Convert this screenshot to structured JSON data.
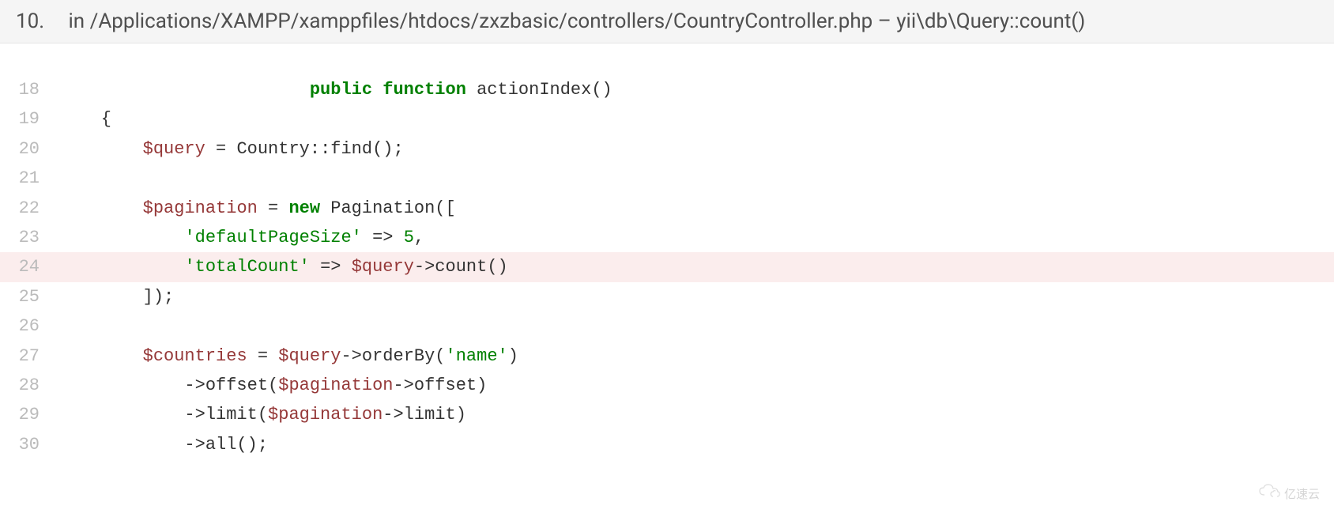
{
  "header": {
    "number": "10.",
    "prefix": "in ",
    "path": "/Applications/XAMPP/xamppfiles/htdocs/zxzbasic/controllers/CountryController.php",
    "separator": " – ",
    "method": "yii\\db\\Query::count()"
  },
  "code": {
    "highlighted_line": 24,
    "lines": [
      {
        "num": "18",
        "tokens": [
          {
            "cls": "",
            "txt": "                        "
          },
          {
            "cls": "tok-keyword",
            "txt": "public"
          },
          {
            "cls": "",
            "txt": " "
          },
          {
            "cls": "tok-function-decl",
            "txt": "function"
          },
          {
            "cls": "",
            "txt": " actionIndex()"
          }
        ]
      },
      {
        "num": "19",
        "tokens": [
          {
            "cls": "",
            "txt": "    {"
          }
        ]
      },
      {
        "num": "20",
        "tokens": [
          {
            "cls": "",
            "txt": "        "
          },
          {
            "cls": "tok-variable",
            "txt": "$query"
          },
          {
            "cls": "",
            "txt": " = Country::find();"
          }
        ]
      },
      {
        "num": "21",
        "tokens": [
          {
            "cls": "",
            "txt": " "
          }
        ]
      },
      {
        "num": "22",
        "tokens": [
          {
            "cls": "",
            "txt": "        "
          },
          {
            "cls": "tok-variable",
            "txt": "$pagination"
          },
          {
            "cls": "",
            "txt": " = "
          },
          {
            "cls": "tok-keyword",
            "txt": "new"
          },
          {
            "cls": "",
            "txt": " Pagination(["
          }
        ]
      },
      {
        "num": "23",
        "tokens": [
          {
            "cls": "",
            "txt": "            "
          },
          {
            "cls": "tok-string",
            "txt": "'defaultPageSize'"
          },
          {
            "cls": "",
            "txt": " => "
          },
          {
            "cls": "tok-number",
            "txt": "5"
          },
          {
            "cls": "",
            "txt": ","
          }
        ]
      },
      {
        "num": "24",
        "tokens": [
          {
            "cls": "",
            "txt": "            "
          },
          {
            "cls": "tok-string",
            "txt": "'totalCount'"
          },
          {
            "cls": "",
            "txt": " => "
          },
          {
            "cls": "tok-variable",
            "txt": "$query"
          },
          {
            "cls": "",
            "txt": "->count()"
          }
        ]
      },
      {
        "num": "25",
        "tokens": [
          {
            "cls": "",
            "txt": "        ]);"
          }
        ]
      },
      {
        "num": "26",
        "tokens": [
          {
            "cls": "",
            "txt": " "
          }
        ]
      },
      {
        "num": "27",
        "tokens": [
          {
            "cls": "",
            "txt": "        "
          },
          {
            "cls": "tok-variable",
            "txt": "$countries"
          },
          {
            "cls": "",
            "txt": " = "
          },
          {
            "cls": "tok-variable",
            "txt": "$query"
          },
          {
            "cls": "",
            "txt": "->orderBy("
          },
          {
            "cls": "tok-string",
            "txt": "'name'"
          },
          {
            "cls": "",
            "txt": ")"
          }
        ]
      },
      {
        "num": "28",
        "tokens": [
          {
            "cls": "",
            "txt": "            ->offset("
          },
          {
            "cls": "tok-variable",
            "txt": "$pagination"
          },
          {
            "cls": "",
            "txt": "->offset)"
          }
        ]
      },
      {
        "num": "29",
        "tokens": [
          {
            "cls": "",
            "txt": "            ->limit("
          },
          {
            "cls": "tok-variable",
            "txt": "$pagination"
          },
          {
            "cls": "",
            "txt": "->limit)"
          }
        ]
      },
      {
        "num": "30",
        "tokens": [
          {
            "cls": "",
            "txt": "            ->all();"
          }
        ]
      }
    ]
  },
  "watermark": {
    "text": "亿速云"
  }
}
